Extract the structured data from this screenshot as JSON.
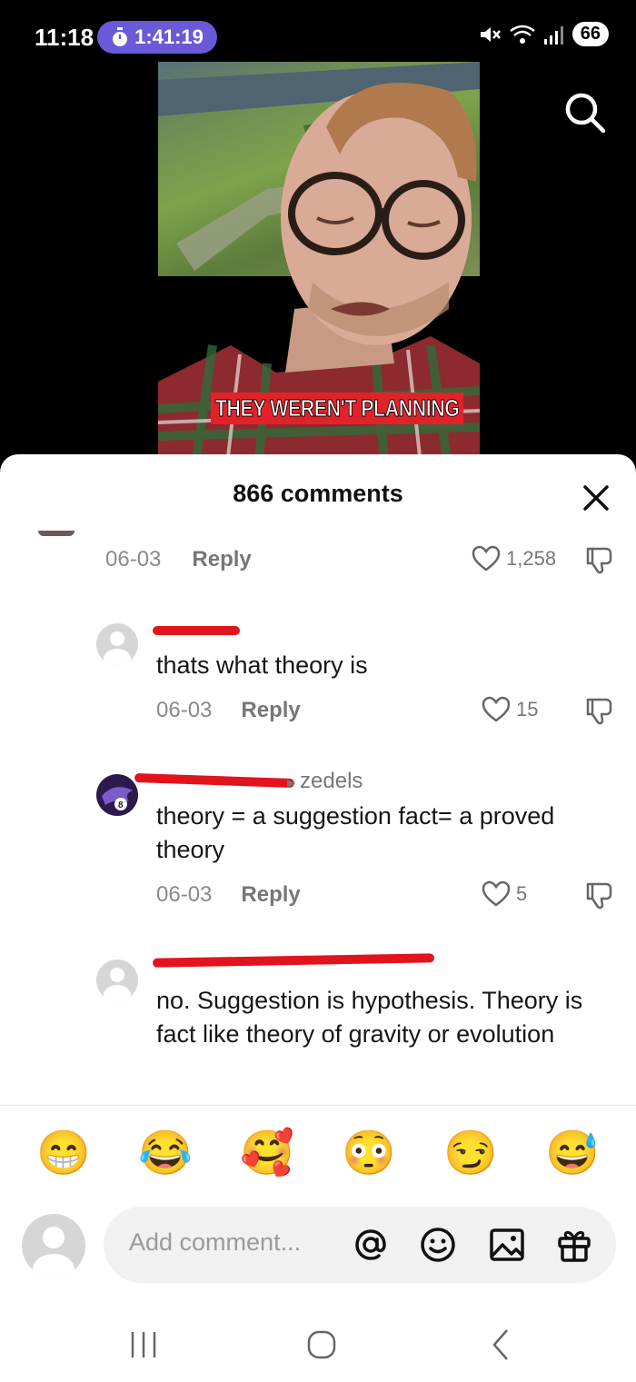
{
  "status": {
    "time": "11:18",
    "timer": "1:41:19",
    "battery": "66"
  },
  "video": {
    "caption": "THEY WEREN'T PLANNING"
  },
  "comments_sheet": {
    "title": "866 comments",
    "comments": [
      {
        "date": "06-03",
        "reply_label": "Reply",
        "likes": "1,258"
      },
      {
        "text": "thats what theory is",
        "date": "06-03",
        "reply_label": "Reply",
        "likes": "15"
      },
      {
        "reply_to": "zedels",
        "text": "theory = a suggestion fact= a proved theory",
        "date": "06-03",
        "reply_label": "Reply",
        "likes": "5"
      },
      {
        "text": "no. Suggestion is hypothesis. Theory is fact like theory of gravity or evolution"
      }
    ]
  },
  "emoji_bar": [
    "😁",
    "😂",
    "🥰",
    "😳",
    "😏",
    "😅"
  ],
  "composer": {
    "placeholder": "Add comment..."
  },
  "colors": {
    "timer_pill": "#6a5ad8",
    "redaction": "#e1141e",
    "caption_bg": "#e2222b"
  }
}
